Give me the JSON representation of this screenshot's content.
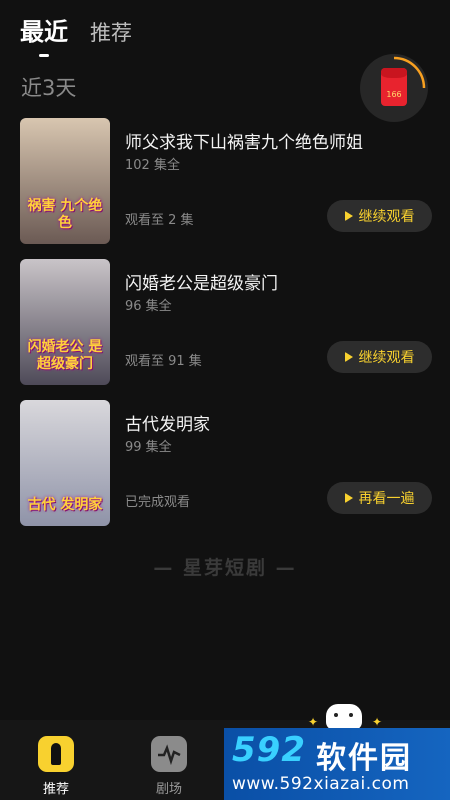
{
  "header": {
    "tabs": [
      {
        "label": "最近",
        "active": true
      },
      {
        "label": "推荐",
        "active": false
      }
    ]
  },
  "section_title": "近3天",
  "red_packet": {
    "value": "166",
    "icon": "red-envelope-icon"
  },
  "dramas": [
    {
      "title": "师父求我下山祸害九个绝色师姐",
      "episodes": "102 集全",
      "progress": "观看至 2 集",
      "action": "继续观看",
      "poster_text": "祸害 九个绝色",
      "poster_colors": [
        "#d8c6b0",
        "#6b5a54"
      ]
    },
    {
      "title": "闪婚老公是超级豪门",
      "episodes": "96 集全",
      "progress": "观看至 91 集",
      "action": "继续观看",
      "poster_text": "闪婚老公 是超级豪门",
      "poster_colors": [
        "#c9c4c8",
        "#4e4a58"
      ]
    },
    {
      "title": "古代发明家",
      "episodes": "99 集全",
      "progress": "已完成观看",
      "action": "再看一遍",
      "poster_text": "古代 发明家",
      "poster_colors": [
        "#d9d8dc",
        "#8f93a8"
      ]
    }
  ],
  "brand_text": "— 星芽短剧 —",
  "bottom_nav": [
    {
      "label": "推荐",
      "active": true
    },
    {
      "label": "剧场",
      "active": false
    }
  ],
  "watermark": {
    "logo": "592",
    "name": "软件园",
    "url": "www.592xiazai.com"
  },
  "colors": {
    "background": "#111111",
    "accent": "#f8d12f",
    "button_bg": "#2d2d2d",
    "watermark_bg": "#1565c0"
  }
}
